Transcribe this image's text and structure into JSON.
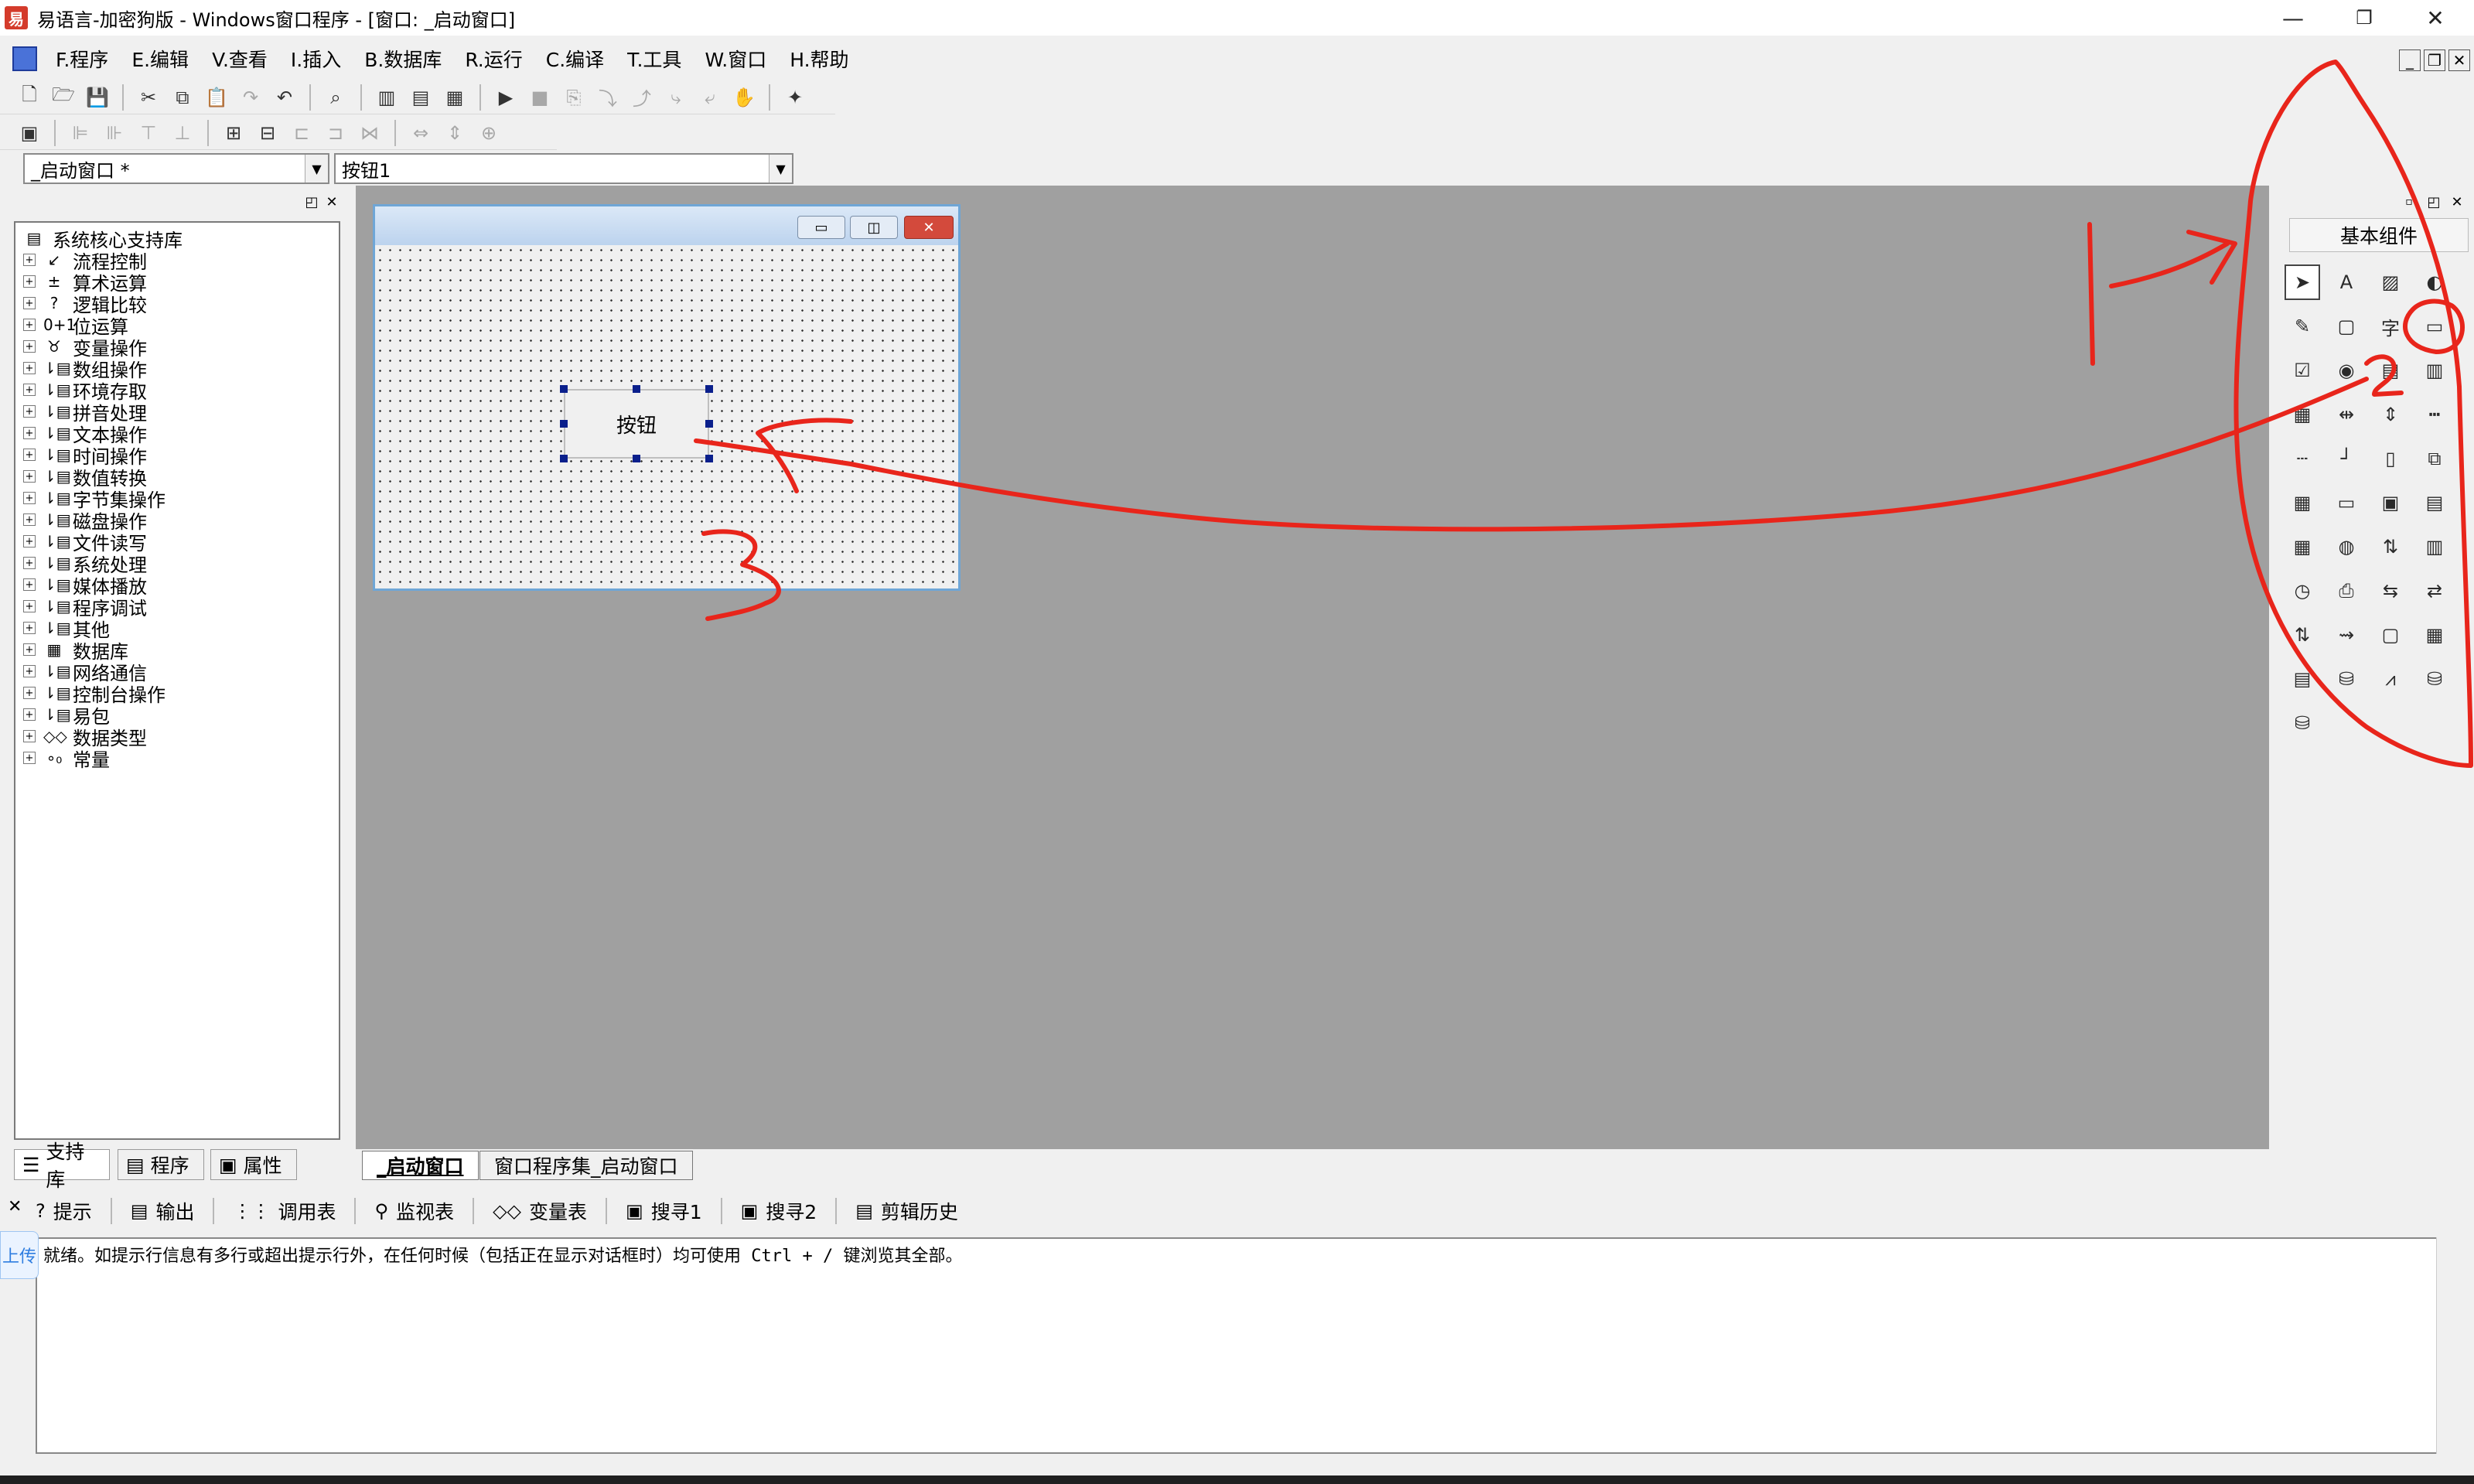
{
  "window": {
    "title": "易语言-加密狗版 - Windows窗口程序 - [窗口: _启动窗口]",
    "controls": [
      "—",
      "❐",
      "✕"
    ]
  },
  "menu": [
    "F.程序",
    "E.编辑",
    "V.查看",
    "I.插入",
    "B.数据库",
    "R.运行",
    "C.编译",
    "T.工具",
    "W.窗口",
    "H.帮助"
  ],
  "combos": {
    "window_select": "_启动窗口 *",
    "control_select": "按钮1"
  },
  "left_panel": {
    "tree": [
      {
        "icon": "▤",
        "label": "系统核心支持库",
        "root": true
      },
      {
        "icon": "↙",
        "label": "流程控制"
      },
      {
        "icon": "±",
        "label": "算术运算"
      },
      {
        "icon": "?",
        "label": "逻辑比较"
      },
      {
        "icon": "0+1",
        "label": "位运算"
      },
      {
        "icon": "♉",
        "label": "变量操作"
      },
      {
        "icon": "⇂▤",
        "label": "数组操作"
      },
      {
        "icon": "⇂▤",
        "label": "环境存取"
      },
      {
        "icon": "⇂▤",
        "label": "拼音处理"
      },
      {
        "icon": "⇂▤",
        "label": "文本操作"
      },
      {
        "icon": "⇂▤",
        "label": "时间操作"
      },
      {
        "icon": "⇂▤",
        "label": "数值转换"
      },
      {
        "icon": "⇂▤",
        "label": "字节集操作"
      },
      {
        "icon": "⇂▤",
        "label": "磁盘操作"
      },
      {
        "icon": "⇂▤",
        "label": "文件读写"
      },
      {
        "icon": "⇂▤",
        "label": "系统处理"
      },
      {
        "icon": "⇂▤",
        "label": "媒体播放"
      },
      {
        "icon": "⇂▤",
        "label": "程序调试"
      },
      {
        "icon": "⇂▤",
        "label": "其他"
      },
      {
        "icon": "▦",
        "label": "数据库"
      },
      {
        "icon": "⇂▤",
        "label": "网络通信"
      },
      {
        "icon": "⇂▤",
        "label": "控制台操作"
      },
      {
        "icon": "⇂▤",
        "label": "易包"
      },
      {
        "icon": "◇◇",
        "label": "数据类型"
      },
      {
        "icon": "∘₀",
        "label": "常量"
      }
    ],
    "tabs": [
      "支持库",
      "程序",
      "属性"
    ]
  },
  "form": {
    "button_label": "按钮"
  },
  "doc_tabs": [
    "_启动窗口",
    "窗口程序集_启动窗口"
  ],
  "component_panel": {
    "header": "基本组件"
  },
  "bottom_panel": {
    "tabs": [
      {
        "icon": "?",
        "label": "提示"
      },
      {
        "icon": "▤",
        "label": "输出"
      },
      {
        "icon": "⋮⋮",
        "label": "调用表"
      },
      {
        "icon": "⚲",
        "label": "监视表"
      },
      {
        "icon": "◇◇",
        "label": "变量表"
      },
      {
        "icon": "▣",
        "label": "搜寻1"
      },
      {
        "icon": "▣",
        "label": "搜寻2"
      },
      {
        "icon": "▤",
        "label": "剪辑历史"
      }
    ],
    "output_text": "就绪。如提示行信息有多行或超出提示行外，在任何时候（包括正在显示对话框时）均可使用 Ctrl + / 键浏览其全部。",
    "upload_badge": "上传"
  },
  "annotations": {
    "labels": [
      "1",
      "2",
      "3"
    ],
    "color": "#e8251b"
  }
}
